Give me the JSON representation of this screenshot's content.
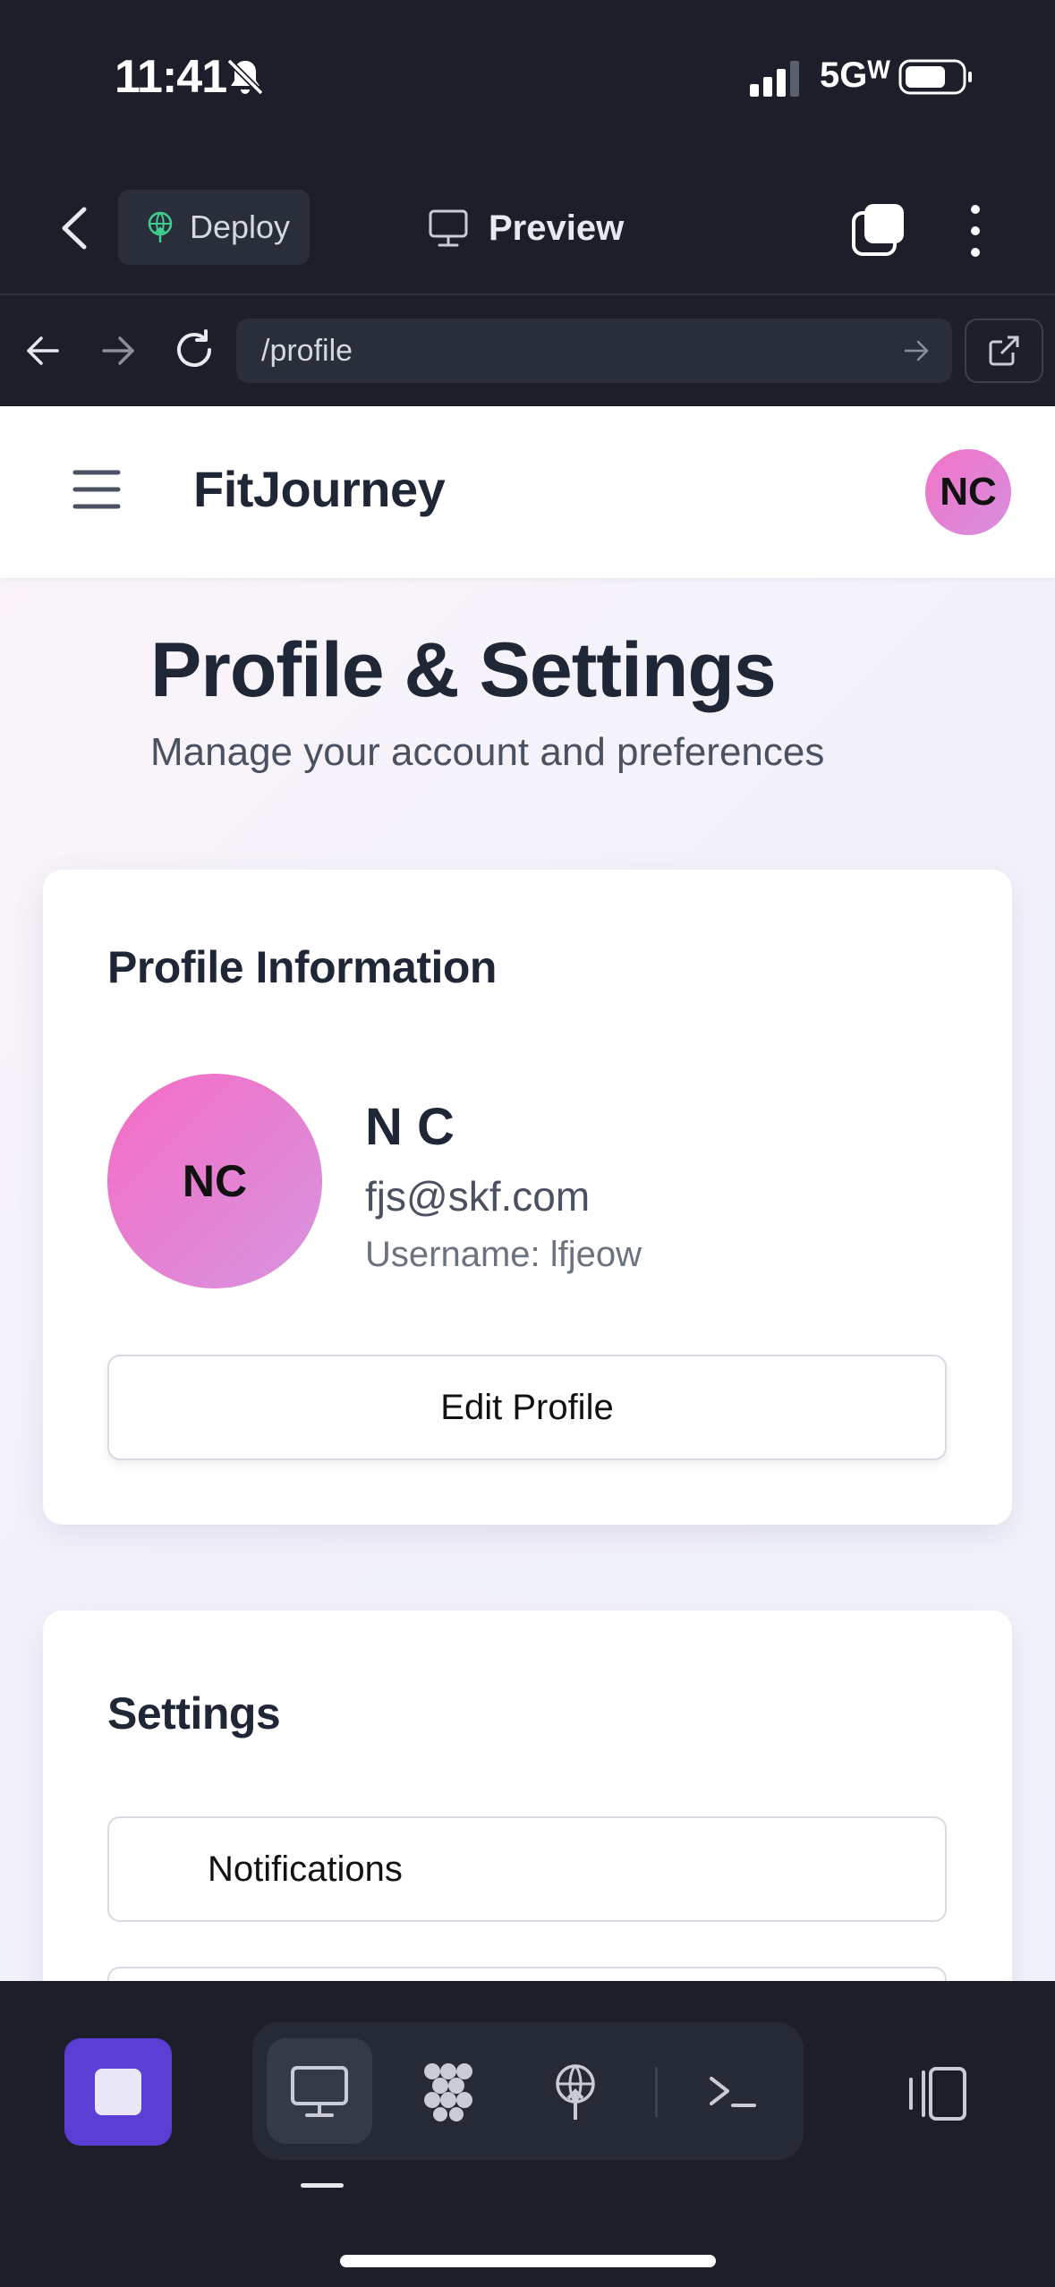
{
  "status": {
    "time": "11:41",
    "network": "5Gᵂ"
  },
  "toolbar": {
    "deploy_label": "Deploy",
    "preview_label": "Preview"
  },
  "browser": {
    "url": "/profile"
  },
  "site": {
    "logo": "FitJourney",
    "header_avatar_initials": "NC"
  },
  "page": {
    "title": "Profile & Settings",
    "subtitle": "Manage your account and preferences"
  },
  "profile_card": {
    "title": "Profile Information",
    "avatar_initials": "NC",
    "name": "N C",
    "email": "fjs@skf.com",
    "username": "Username: lfjeow",
    "edit_button": "Edit Profile"
  },
  "settings_card": {
    "title": "Settings",
    "items": [
      {
        "label": "Notifications"
      },
      {
        "label": ""
      }
    ]
  },
  "colors": {
    "accent": "#5b3fd4",
    "avatar_gradient_start": "#f56cc4",
    "avatar_gradient_end": "#d795e0",
    "chrome_bg": "#1c1f2a"
  }
}
